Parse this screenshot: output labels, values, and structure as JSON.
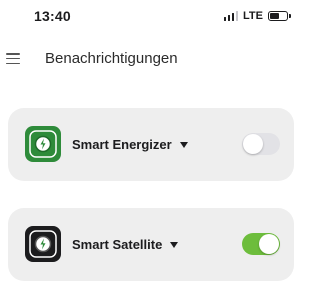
{
  "status_bar": {
    "time": "13:40",
    "network": "LTE",
    "icons": [
      "signal-icon",
      "battery-icon"
    ]
  },
  "nav": {
    "menu_icon": "hamburger-menu-icon",
    "title": "Benachrichtigungen"
  },
  "devices": [
    {
      "name": "Smart Energizer",
      "icon": "smart-energizer-icon",
      "icon_color": "#2e8b3a",
      "dropdown_icon": "caret-down-icon",
      "notifications_enabled": false
    },
    {
      "name": "Smart Satellite",
      "icon": "smart-satellite-icon",
      "icon_color": "#1c1c1e",
      "dropdown_icon": "caret-down-icon",
      "notifications_enabled": true
    }
  ],
  "colors": {
    "toggle_on": "#6dbd3c",
    "toggle_off": "#e2e2e6",
    "card_background": "#eeeeee"
  }
}
